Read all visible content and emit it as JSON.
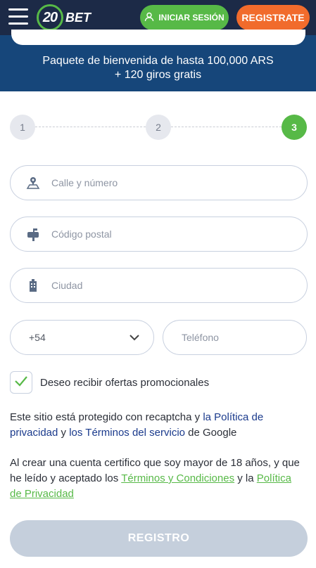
{
  "header": {
    "logo_number": "20",
    "logo_text": "BET",
    "login_label": "INICIAR SESIÓN",
    "register_label": "REGISTRATE"
  },
  "banner": {
    "line1": "Paquete de bienvenida de hasta 100,000 ARS",
    "line2": "+ 120 giros gratis"
  },
  "steps": [
    "1",
    "2",
    "3"
  ],
  "active_step": 3,
  "form": {
    "street_placeholder": "Calle y número",
    "postal_placeholder": "Código postal",
    "city_placeholder": "Ciudad",
    "country_code": "+54",
    "phone_placeholder": "Teléfono",
    "promo_label": "Deseo recibir ofertas promocionales",
    "promo_checked": true
  },
  "recaptcha": {
    "prefix": "Este sitio está protegido con recaptcha y ",
    "privacy_link": "la Política de privacidad",
    "mid": " y ",
    "terms_link": "los Términos del servicio",
    "suffix": " de Google"
  },
  "consent": {
    "prefix": "Al crear una cuenta certifico que soy mayor de 18 años, y que he leído y aceptado los ",
    "terms_link": "Términos y Condiciones",
    "mid": " y la ",
    "privacy_link": "Política de Privacidad"
  },
  "submit_label": "REGISTRO",
  "colors": {
    "header_bg": "#1c2a47",
    "banner_bg": "#16467a",
    "green": "#57b947",
    "orange": "#f16b2c",
    "link_blue": "#1a3a8c",
    "disabled_button": "#c5cfdc"
  }
}
